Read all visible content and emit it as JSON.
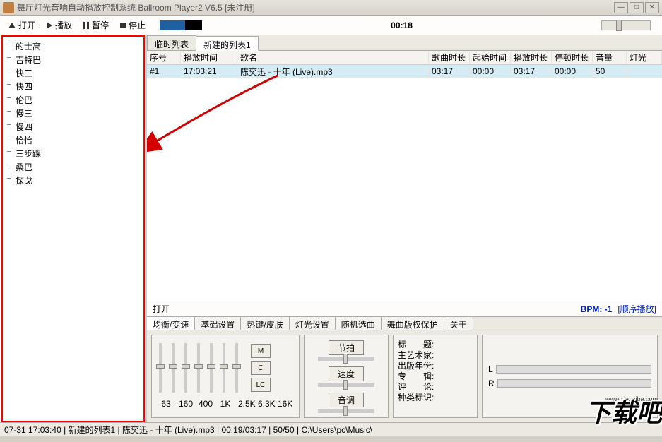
{
  "window": {
    "title": "舞厅灯光音响自动播放控制系统 Ballroom Player2 V6.5 [未注册]"
  },
  "toolbar": {
    "open": "打开",
    "play": "播放",
    "pause": "暂停",
    "stop": "停止",
    "time": "00:18"
  },
  "sidebar": {
    "items": [
      "的士高",
      "吉特巴",
      "快三",
      "快四",
      "伦巴",
      "慢三",
      "慢四",
      "恰恰",
      "三步踩",
      "桑巴",
      "探戈"
    ]
  },
  "listTabs": {
    "t1": "临时列表",
    "t2": "新建的列表1"
  },
  "playlist": {
    "headers": {
      "num": "序号",
      "ptime": "播放时间",
      "name": "歌名",
      "slen": "歌曲时长",
      "start": "起始时间",
      "plen": "播放时长",
      "stop": "停顿时长",
      "vol": "音量",
      "light": "灯光"
    },
    "rows": [
      {
        "num": "#1",
        "ptime": "17:03:21",
        "name": "陈奕迅 - 十年 (Live).mp3",
        "slen": "03:17",
        "start": "00:00",
        "plen": "03:17",
        "stop": "00:00",
        "vol": "50",
        "light": ""
      }
    ]
  },
  "infoRow": {
    "left": "打开",
    "bpm": "BPM: -1",
    "order": "[顺序播放]"
  },
  "settingsTabs": [
    "均衡/变速",
    "基础设置",
    "热键/皮肤",
    "灯光设置",
    "随机选曲",
    "舞曲版权保护",
    "关于"
  ],
  "eq": {
    "labels": [
      "63",
      "160",
      "400",
      "1K",
      "2.5K",
      "6.3K",
      "16K"
    ],
    "btns": {
      "m": "M",
      "c": "C",
      "lc": "LC"
    }
  },
  "tempo": {
    "beat": "节拍",
    "speed": "速度",
    "pitch": "音调"
  },
  "meta": {
    "l1": "标　　题:",
    "l2": "主艺术家:",
    "l3": "出版年份:",
    "l4": "专　　辑:",
    "l5": "评　　论:",
    "l6": "种类标识:"
  },
  "lr": {
    "l": "L",
    "r": "R"
  },
  "statusbar": "07-31 17:03:40 | 新建的列表1 | 陈奕迅 - 十年 (Live).mp3 | 00:19/03:17 | 50/50 | C:\\Users\\pc\\Music\\",
  "watermark": {
    "main": "下载吧",
    "sub": "www.xiazaiba.com"
  }
}
